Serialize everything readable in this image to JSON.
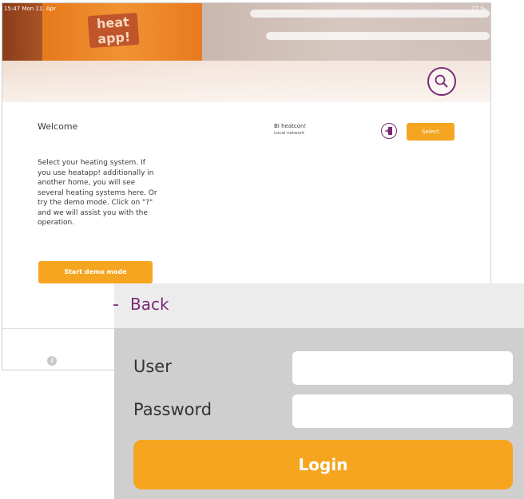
{
  "status_bar": {
    "time": "15:47  Mon 11. Apr",
    "battery": "77 %"
  },
  "hero": {
    "logo_text_line1": "heat",
    "logo_text_line2": "app!"
  },
  "welcome": {
    "title": "Welcome",
    "description": "Select your heating system. If you use heatapp! additionally in another home, you will see several heating systems here. Or try the demo mode. Click on \"?\" and we will assist you with the operation."
  },
  "system": {
    "name": "BI heatcon!",
    "subtitle": "Local network",
    "select_label": "Select"
  },
  "demo": {
    "button_label": "Start demo mode"
  },
  "login_panel": {
    "back_label": "Back",
    "user_label": "User",
    "password_label": "Password",
    "login_label": "Login"
  },
  "colors": {
    "accent": "#f5a51f",
    "brand": "#7a2a74"
  }
}
